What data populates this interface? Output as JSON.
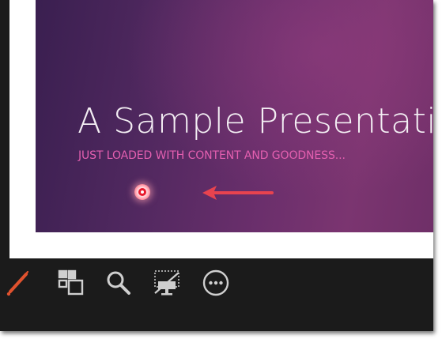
{
  "slide": {
    "title": "A Sample Presentati",
    "subtitle": "JUST LOADED WITH CONTENT AND GOODNESS..."
  },
  "toolbar": {
    "tools": [
      {
        "icon": "laser-pen-icon",
        "active": true,
        "color": "#e0522e"
      },
      {
        "icon": "see-all-slides-icon"
      },
      {
        "icon": "zoom-magnifier-icon"
      },
      {
        "icon": "black-screen-icon"
      },
      {
        "icon": "more-options-icon"
      }
    ]
  },
  "colors": {
    "toolbar_bg": "#1b1b1b",
    "icon_color": "#cfcfcf",
    "laser_color": "#e8192c",
    "subtitle_color": "#e45fb0",
    "arrow_color": "#e8434f"
  }
}
